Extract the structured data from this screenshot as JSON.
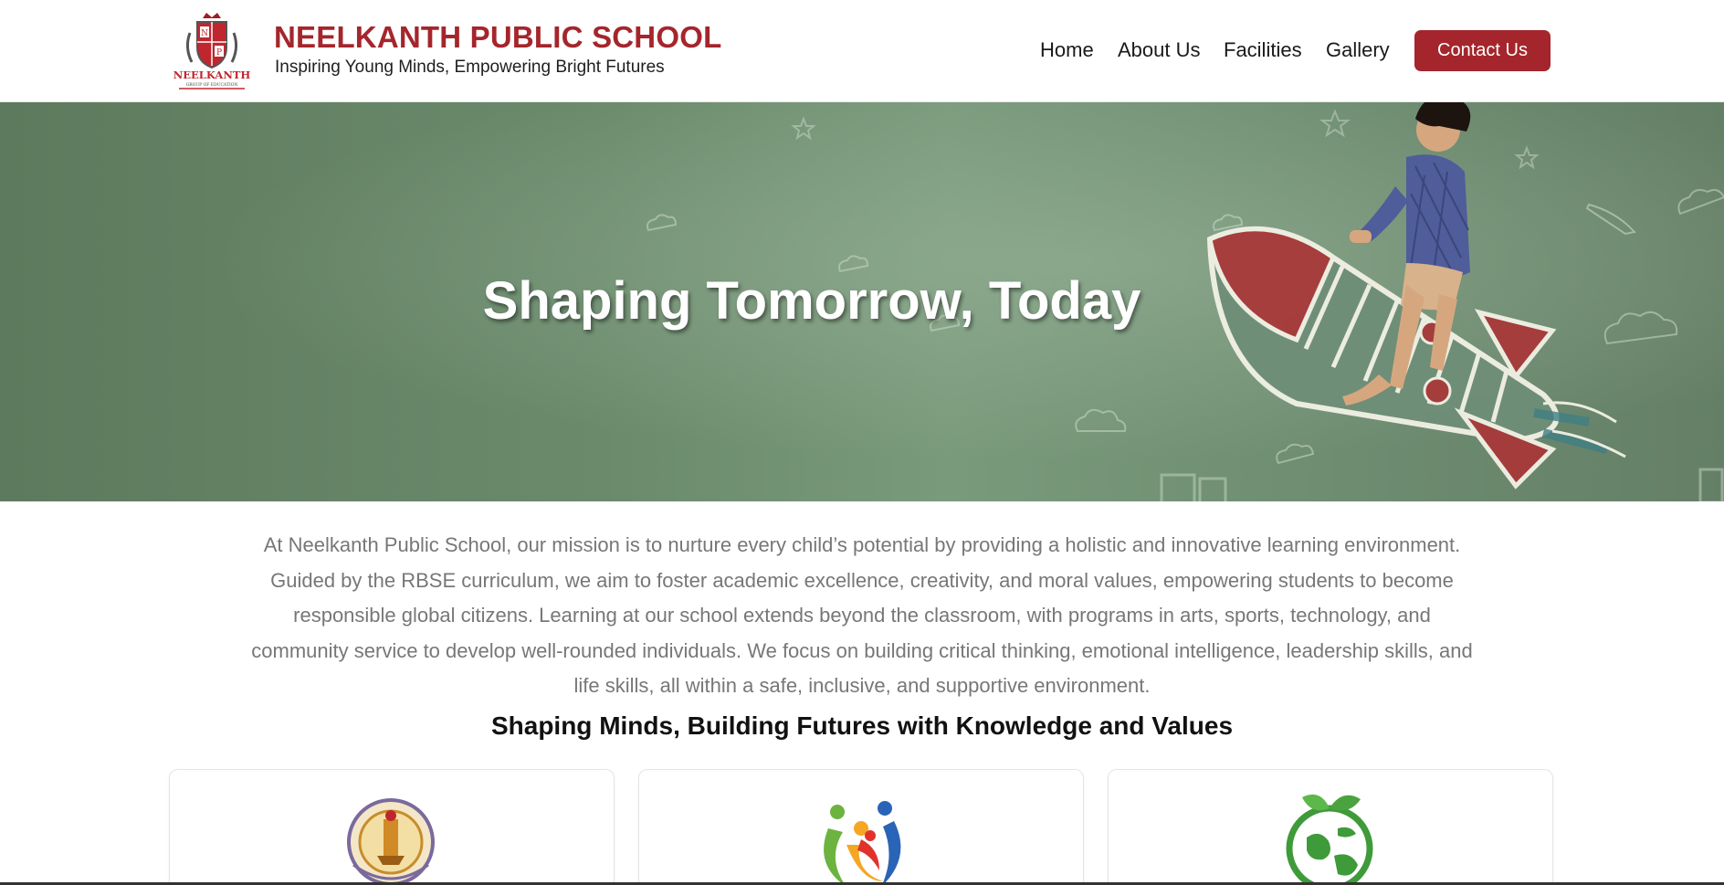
{
  "header": {
    "school_name": "NEELKANTH PUBLIC SCHOOL",
    "tagline": "Inspiring Young Minds, Empowering Bright Futures",
    "logo": {
      "icon": "school-crest-icon",
      "text": "NEELKANTH",
      "subtext": "GROUP OF EDUCATION",
      "letters": [
        "N",
        "P",
        "S"
      ]
    },
    "nav": [
      {
        "label": "Home"
      },
      {
        "label": "About Us"
      },
      {
        "label": "Facilities"
      },
      {
        "label": "Gallery"
      }
    ],
    "contact_label": "Contact Us"
  },
  "hero": {
    "title": "Shaping Tomorrow, Today",
    "image": "boy-on-chalk-rocket-image"
  },
  "mission": {
    "text": "At Neelkanth Public School, our mission is to nurture every child’s potential by providing a holistic and innovative learning environment. Guided by the RBSE curriculum, we aim to foster academic excellence, creativity, and moral values, empowering students to become responsible global citizens. Learning at our school extends beyond the classroom, with programs in arts, sports, technology, and community service to develop well-rounded individuals. We focus on building critical thinking, emotional intelligence, leadership skills, and life skills, all within a safe, inclusive, and supportive environment."
  },
  "values_section": {
    "title": "Shaping Minds, Building Futures with Knowledge and Values",
    "cards": [
      {
        "icon": "rbse-board-seal-icon"
      },
      {
        "icon": "colorful-people-icon"
      },
      {
        "icon": "green-globe-leaf-icon"
      }
    ]
  },
  "colors": {
    "brand": "#a4262c",
    "hero_green": "#6b8a6c",
    "text_muted": "#777777"
  }
}
